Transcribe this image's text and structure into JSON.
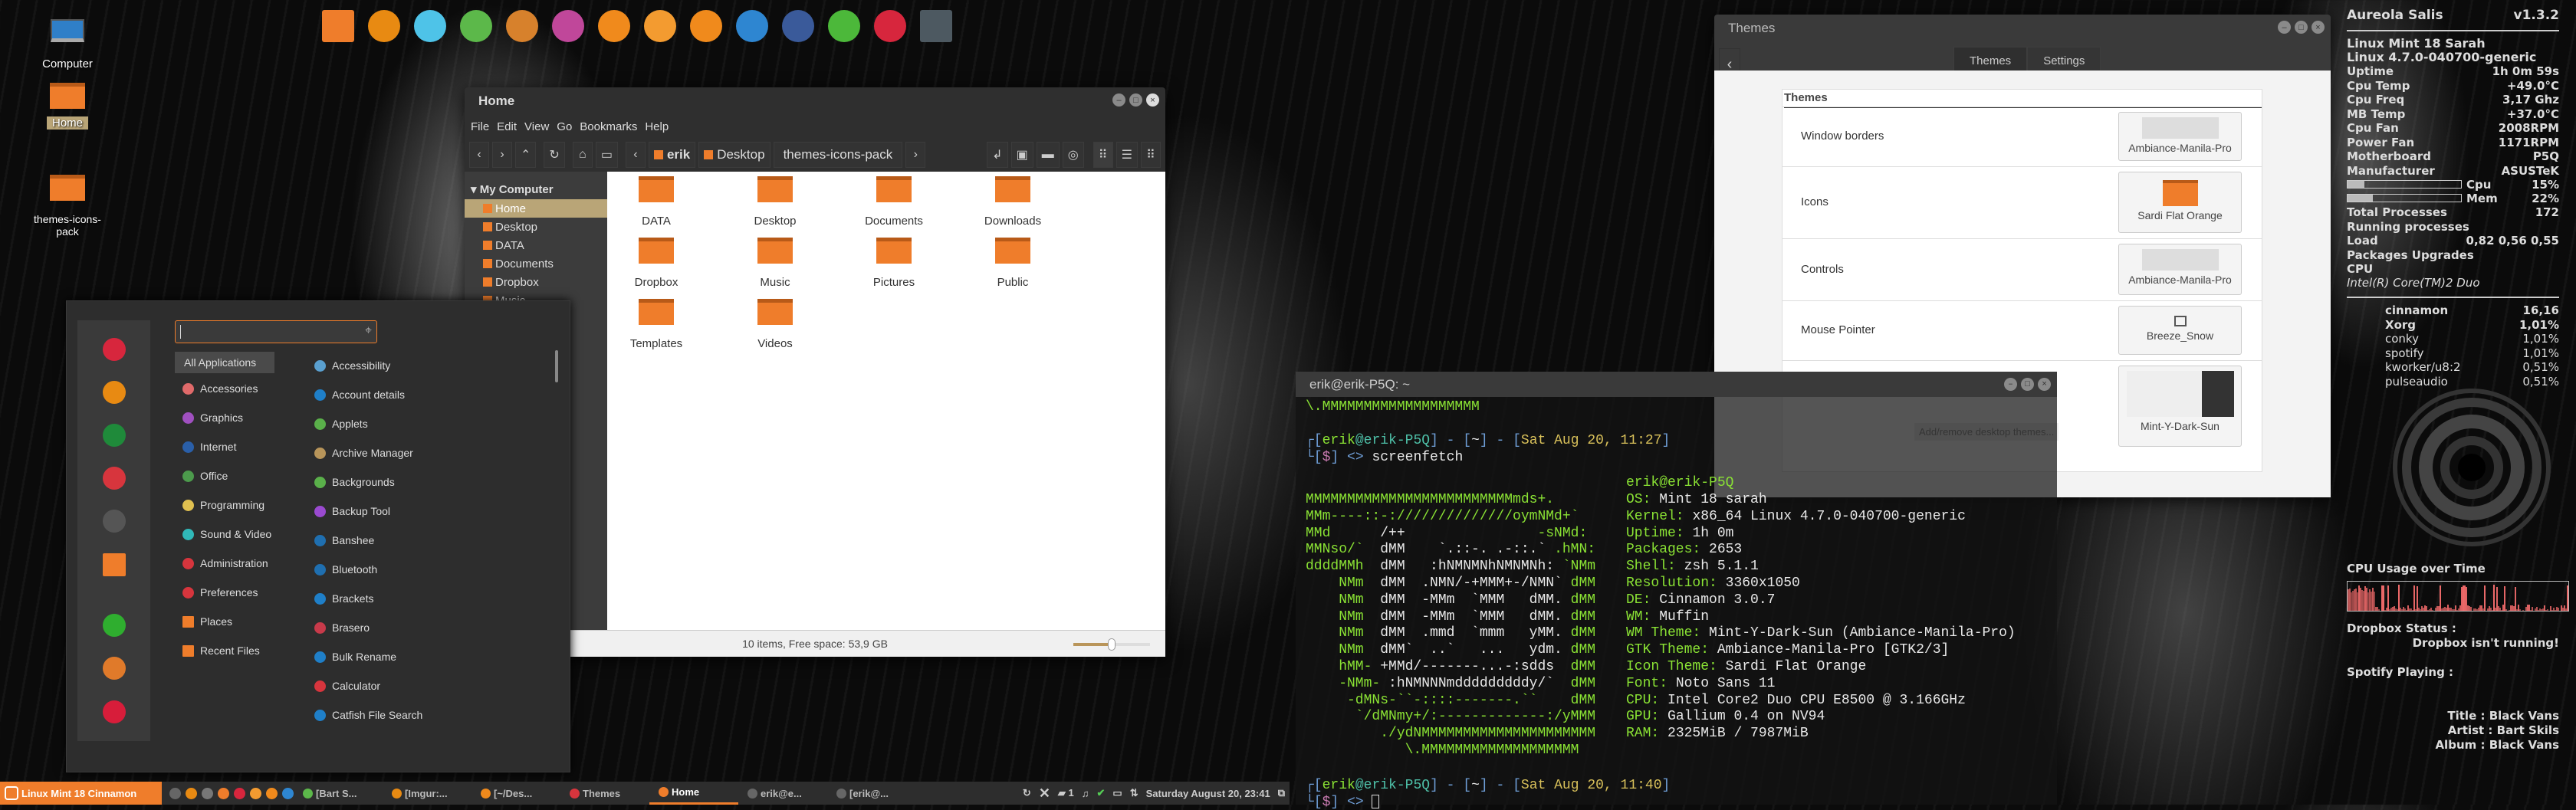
{
  "desktop": {
    "icons": [
      {
        "label": "Computer"
      },
      {
        "label": "Home"
      },
      {
        "label": "themes-icons-pack"
      }
    ]
  },
  "dock": [
    {
      "icon": "files-icon",
      "color": "#ef7d2b"
    },
    {
      "icon": "firefox-icon",
      "color": "#e88a12"
    },
    {
      "icon": "text-editor-icon",
      "color": "#4ec3e8"
    },
    {
      "icon": "spotify-icon",
      "color": "#5cb84a"
    },
    {
      "icon": "gimp-icon",
      "color": "#d7812c"
    },
    {
      "icon": "inkscape-icon",
      "color": "#c0479a"
    },
    {
      "icon": "sublime-icon",
      "color": "#f08a1c"
    },
    {
      "icon": "citrus-icon",
      "color": "#f39b30"
    },
    {
      "icon": "vlc-icon",
      "color": "#f08a1c"
    },
    {
      "icon": "brackets-icon",
      "color": "#2e86d1"
    },
    {
      "icon": "shotwell-icon",
      "color": "#3a5a9a"
    },
    {
      "icon": "system-monitor-icon",
      "color": "#4cb83a"
    },
    {
      "icon": "bowtie-icon",
      "color": "#d7263d"
    },
    {
      "icon": "terminal-icon",
      "color": "#4d5961"
    }
  ],
  "filemanager": {
    "title": "Home",
    "menu": [
      "File",
      "Edit",
      "View",
      "Go",
      "Bookmarks",
      "Help"
    ],
    "breadcrumb": [
      "erik",
      "Desktop",
      "themes-icons-pack"
    ],
    "sidebar": {
      "section": "My Computer",
      "items": [
        "Home",
        "Desktop",
        "DATA",
        "Documents",
        "Dropbox",
        "Music"
      ],
      "selected": "Home"
    },
    "items": [
      "DATA",
      "Desktop",
      "Documents",
      "Downloads",
      "Dropbox",
      "Music",
      "Pictures",
      "Public",
      "Templates",
      "Videos"
    ],
    "status": "10 items, Free space: 53,9 GB",
    "zoom_level": 0.5
  },
  "menu": {
    "search_value": "",
    "favorites": [
      {
        "icon": "bowtie-icon",
        "color": "#d7263d"
      },
      {
        "icon": "firefox-icon",
        "color": "#e88a12"
      },
      {
        "icon": "download-icon",
        "color": "#1f8a3a"
      },
      {
        "icon": "admin-icon",
        "color": "#d7353d"
      },
      {
        "icon": "terminal-icon",
        "color": "#555"
      },
      {
        "icon": "folder-icon",
        "color": "#ef7d2b"
      },
      {
        "icon": "lock-icon",
        "color": "#2fae2f"
      },
      {
        "icon": "logout-icon",
        "color": "#e07a2a"
      },
      {
        "icon": "power-icon",
        "color": "#d71d3a"
      }
    ],
    "categories": [
      {
        "label": "All Applications",
        "color": ""
      },
      {
        "label": "Accessories",
        "color": "#e06a6a"
      },
      {
        "label": "Graphics",
        "color": "#a050c0"
      },
      {
        "label": "Internet",
        "color": "#2a5fa8"
      },
      {
        "label": "Office",
        "color": "#4c9a4c"
      },
      {
        "label": "Programming",
        "color": "#e0c050"
      },
      {
        "label": "Sound & Video",
        "color": "#30b8b8"
      },
      {
        "label": "Administration",
        "color": "#d7353d"
      },
      {
        "label": "Preferences",
        "color": "#d7353d"
      },
      {
        "label": "Places",
        "color": "#ef7d2b"
      },
      {
        "label": "Recent Files",
        "color": "#ef7d2b"
      }
    ],
    "apps": [
      {
        "label": "Accessibility",
        "color": "#5aa0d0"
      },
      {
        "label": "Account details",
        "color": "#1f7fc8"
      },
      {
        "label": "Applets",
        "color": "#5ab04a"
      },
      {
        "label": "Archive Manager",
        "color": "#b8955a"
      },
      {
        "label": "Backgrounds",
        "color": "#5ab04a"
      },
      {
        "label": "Backup Tool",
        "color": "#9a4ad0"
      },
      {
        "label": "Banshee",
        "color": "#1f6fb0"
      },
      {
        "label": "Bluetooth",
        "color": "#1f6fb0"
      },
      {
        "label": "Brackets",
        "color": "#1f7fc8"
      },
      {
        "label": "Brasero",
        "color": "#c83a4a"
      },
      {
        "label": "Bulk Rename",
        "color": "#1f7fc8"
      },
      {
        "label": "Calculator",
        "color": "#d7353d"
      },
      {
        "label": "Catfish File Search",
        "color": "#1f7fc8"
      }
    ]
  },
  "themes": {
    "title": "Themes",
    "tabs": [
      "Themes",
      "Settings"
    ],
    "active_tab": "Themes",
    "section": "Themes",
    "rows": [
      {
        "label": "Window borders",
        "value": "Ambiance-Manila-Pro"
      },
      {
        "label": "Icons",
        "value": "Sardi Flat Orange"
      },
      {
        "label": "Controls",
        "value": "Ambiance-Manila-Pro"
      },
      {
        "label": "Mouse Pointer",
        "value": "Breeze_Snow"
      },
      {
        "label": "Desktop",
        "value": "Mint-Y-Dark-Sun"
      }
    ],
    "add_remove": "Add/remove desktop themes..."
  },
  "terminal": {
    "title": "erik@erik-P5Q: ~",
    "top_line": "\\.MMMMMMMMMMMMMMMMMMM",
    "prompt1": {
      "user": "erik",
      "host": "erik-P5Q",
      "dir": "~",
      "date": "Sat Aug 20, 11:27",
      "command": "screenfetch"
    },
    "prompt2": {
      "user": "erik",
      "host": "erik-P5Q",
      "dir": "~",
      "date": "Sat Aug 20, 11:40",
      "command": ""
    },
    "userhost": "erik@erik-P5Q",
    "ascii": [
      [
        [
          "MMMMMMMMMMMMMMMMMMMMMMMMMmds+.",
          "g"
        ]
      ],
      [
        [
          "MMm----::-://////////////oymNMd+`",
          "g"
        ]
      ],
      [
        [
          "MMd      ",
          "g"
        ],
        [
          "/++",
          "w"
        ],
        [
          "                -sNMd:",
          "g"
        ]
      ],
      [
        [
          "MMNso/`  ",
          "g"
        ],
        [
          "dMM    `.::-. .-::.`",
          "w"
        ],
        [
          " .hMN:",
          "g"
        ]
      ],
      [
        [
          "ddddMMh  ",
          "g"
        ],
        [
          "dMM   :hNMNMNhNMNMNh:",
          "w"
        ],
        [
          " `NMm",
          "g"
        ]
      ],
      [
        [
          "    NMm  ",
          "g"
        ],
        [
          "dMM  .NMN/-+MMM+-/NMN`",
          "w"
        ],
        [
          " dMM",
          "g"
        ]
      ],
      [
        [
          "    NMm  ",
          "g"
        ],
        [
          "dMM  -MMm  `MMM   dMM.",
          "w"
        ],
        [
          " dMM",
          "g"
        ]
      ],
      [
        [
          "    NMm  ",
          "g"
        ],
        [
          "dMM  -MMm  `MMM   dMM.",
          "w"
        ],
        [
          " dMM",
          "g"
        ]
      ],
      [
        [
          "    NMm  ",
          "g"
        ],
        [
          "dMM  .mmd  `mmm   yMM.",
          "w"
        ],
        [
          " dMM",
          "g"
        ]
      ],
      [
        [
          "    NMm  ",
          "g"
        ],
        [
          "dMM`  ..`   ...   ydm.",
          "w"
        ],
        [
          " dMM",
          "g"
        ]
      ],
      [
        [
          "    hMM- ",
          "g"
        ],
        [
          "+MMd/-------...-:sdds",
          "w"
        ],
        [
          "  dMM",
          "g"
        ]
      ],
      [
        [
          "    -NMm- ",
          "g"
        ],
        [
          ":hNMNNNmdddddddddy/`",
          "w"
        ],
        [
          "  dMM",
          "g"
        ]
      ],
      [
        [
          "     -dMNs-``-::::-------.``",
          "g"
        ],
        [
          "    dMM",
          "g"
        ]
      ],
      [
        [
          "      `/dMNmy+/:-------------:/yMMM",
          "g"
        ]
      ],
      [
        [
          "         ./ydNMMMMMMMMMMMMMMMMMMMMM",
          "g"
        ]
      ],
      [
        [
          "            \\.MMMMMMMMMMMMMMMMMMM",
          "g"
        ]
      ]
    ],
    "info": [
      {
        "k": "OS:",
        "v": "Mint 18 sarah"
      },
      {
        "k": "Kernel:",
        "v": "x86_64 Linux 4.7.0-040700-generic"
      },
      {
        "k": "Uptime:",
        "v": "1h 0m"
      },
      {
        "k": "Packages:",
        "v": "2653"
      },
      {
        "k": "Shell:",
        "v": "zsh 5.1.1"
      },
      {
        "k": "Resolution:",
        "v": "3360x1050"
      },
      {
        "k": "DE:",
        "v": "Cinnamon 3.0.7"
      },
      {
        "k": "WM:",
        "v": "Muffin"
      },
      {
        "k": "WM Theme:",
        "v": "Mint-Y-Dark-Sun (Ambiance-Manila-Pro)"
      },
      {
        "k": "GTK Theme:",
        "v": "Ambiance-Manila-Pro [GTK2/3]"
      },
      {
        "k": "Icon Theme:",
        "v": "Sardi Flat Orange"
      },
      {
        "k": "Font:",
        "v": "Noto Sans 11"
      },
      {
        "k": "CPU:",
        "v": "Intel Core2 Duo CPU E8500 @ 3.166GHz"
      },
      {
        "k": "GPU:",
        "v": "Gallium 0.4 on NV94"
      },
      {
        "k": "RAM:",
        "v": "2325MiB / 7987MiB"
      }
    ]
  },
  "taskbar": {
    "menu_label": "Linux Mint 18 Cinnamon",
    "accent": "#ef7d2b",
    "windows": [
      {
        "label": "[Bart S...",
        "icon": "spotify-icon",
        "color": "#5cb84a"
      },
      {
        "label": "[Imgur:...",
        "icon": "firefox-icon",
        "color": "#e88a12"
      },
      {
        "label": "[~/Des...",
        "icon": "sublime-icon",
        "color": "#f08a1c"
      },
      {
        "label": "Themes",
        "icon": "themes-icon",
        "color": "#d7353d"
      },
      {
        "label": "Home",
        "icon": "folder-icon",
        "color": "#ef7d2b"
      },
      {
        "label": "erik@e...",
        "icon": "terminal-icon",
        "color": "#666"
      },
      {
        "label": "[erik@...",
        "icon": "terminal-icon",
        "color": "#666"
      }
    ],
    "active_window": "Home",
    "notification_count": "1",
    "clock": "Saturday August 20, 23:41"
  },
  "conky": {
    "title": "Aureola Salis",
    "version": "v1.3.2",
    "distro": "Linux Mint 18 Sarah",
    "kernel": "Linux 4.7.0-040700-generic",
    "stats": [
      {
        "k": "Uptime",
        "v": "1h 0m 59s"
      },
      {
        "k": "Cpu Temp",
        "v": "+49.0°C"
      },
      {
        "k": "Cpu Freq",
        "v": "3,17 Ghz"
      },
      {
        "k": "MB Temp",
        "v": "+37.0°C"
      },
      {
        "k": "Cpu Fan",
        "v": "2008RPM"
      },
      {
        "k": "Power Fan",
        "v": "1171RPM"
      },
      {
        "k": "Motherboard",
        "v": "P5Q"
      },
      {
        "k": "Manufacturer",
        "v": "ASUSTeK"
      }
    ],
    "cpu": {
      "label": "Cpu",
      "value": "15%",
      "fraction": 0.15
    },
    "mem": {
      "label": "Mem",
      "value": "22%",
      "fraction": 0.22
    },
    "total_processes": {
      "k": "Total Processes",
      "v": "172"
    },
    "running": "Running processes",
    "load": {
      "k": "Load",
      "v": "0,82 0,56 0,55"
    },
    "packages": "Packages Upgrades",
    "cpu_label": "CPU",
    "cpu_model": "Intel(R) Core(TM)2 Duo",
    "top": [
      {
        "n": "cinnamon",
        "v": "16,16",
        "bold": true
      },
      {
        "n": "Xorg",
        "v": "1,01%",
        "bold": true
      },
      {
        "n": "conky",
        "v": "1,01%"
      },
      {
        "n": "spotify",
        "v": "1,01%"
      },
      {
        "n": "kworker/u8:2",
        "v": "0,51%"
      },
      {
        "n": "pulseaudio",
        "v": "0,51%"
      }
    ],
    "graph_title": "CPU Usage over Time",
    "graph_color": "#f06a6a",
    "dropbox_label": "Dropbox Status :",
    "dropbox_value": "Dropbox isn't running!",
    "spotify_label": "Spotify Playing :",
    "track": {
      "title": "Title : Black Vans",
      "artist": "Artist : Bart Skils",
      "album": "Album : Black Vans"
    }
  }
}
